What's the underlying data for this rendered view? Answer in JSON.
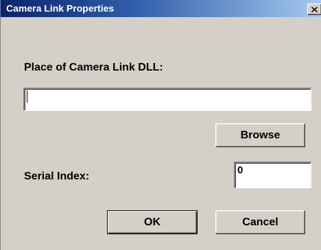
{
  "window": {
    "title": "Camera Link Properties",
    "close_icon": "close-icon"
  },
  "dll": {
    "label": "Place of Camera Link DLL:",
    "value": "",
    "browse_label": "Browse"
  },
  "serial": {
    "label": "Serial Index:",
    "value": "0"
  },
  "actions": {
    "ok_label": "OK",
    "cancel_label": "Cancel"
  }
}
